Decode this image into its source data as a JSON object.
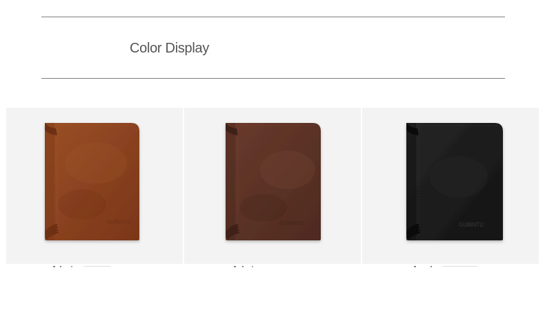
{
  "section": {
    "title": "Color Display"
  },
  "products": [
    {
      "color_name": "brown",
      "leather_color": "#8c431e",
      "logo_text": "GUBINTU"
    },
    {
      "color_name": "coffee",
      "leather_color": "#5e3327",
      "logo_text": "GUBINTU"
    },
    {
      "color_name": "black",
      "leather_color": "#1a1a1a",
      "logo_text": "GUBINTU"
    }
  ],
  "colors": {
    "rule": "#7f7f7f",
    "title_text": "#555555",
    "tile_background": "#f3f3f3"
  }
}
